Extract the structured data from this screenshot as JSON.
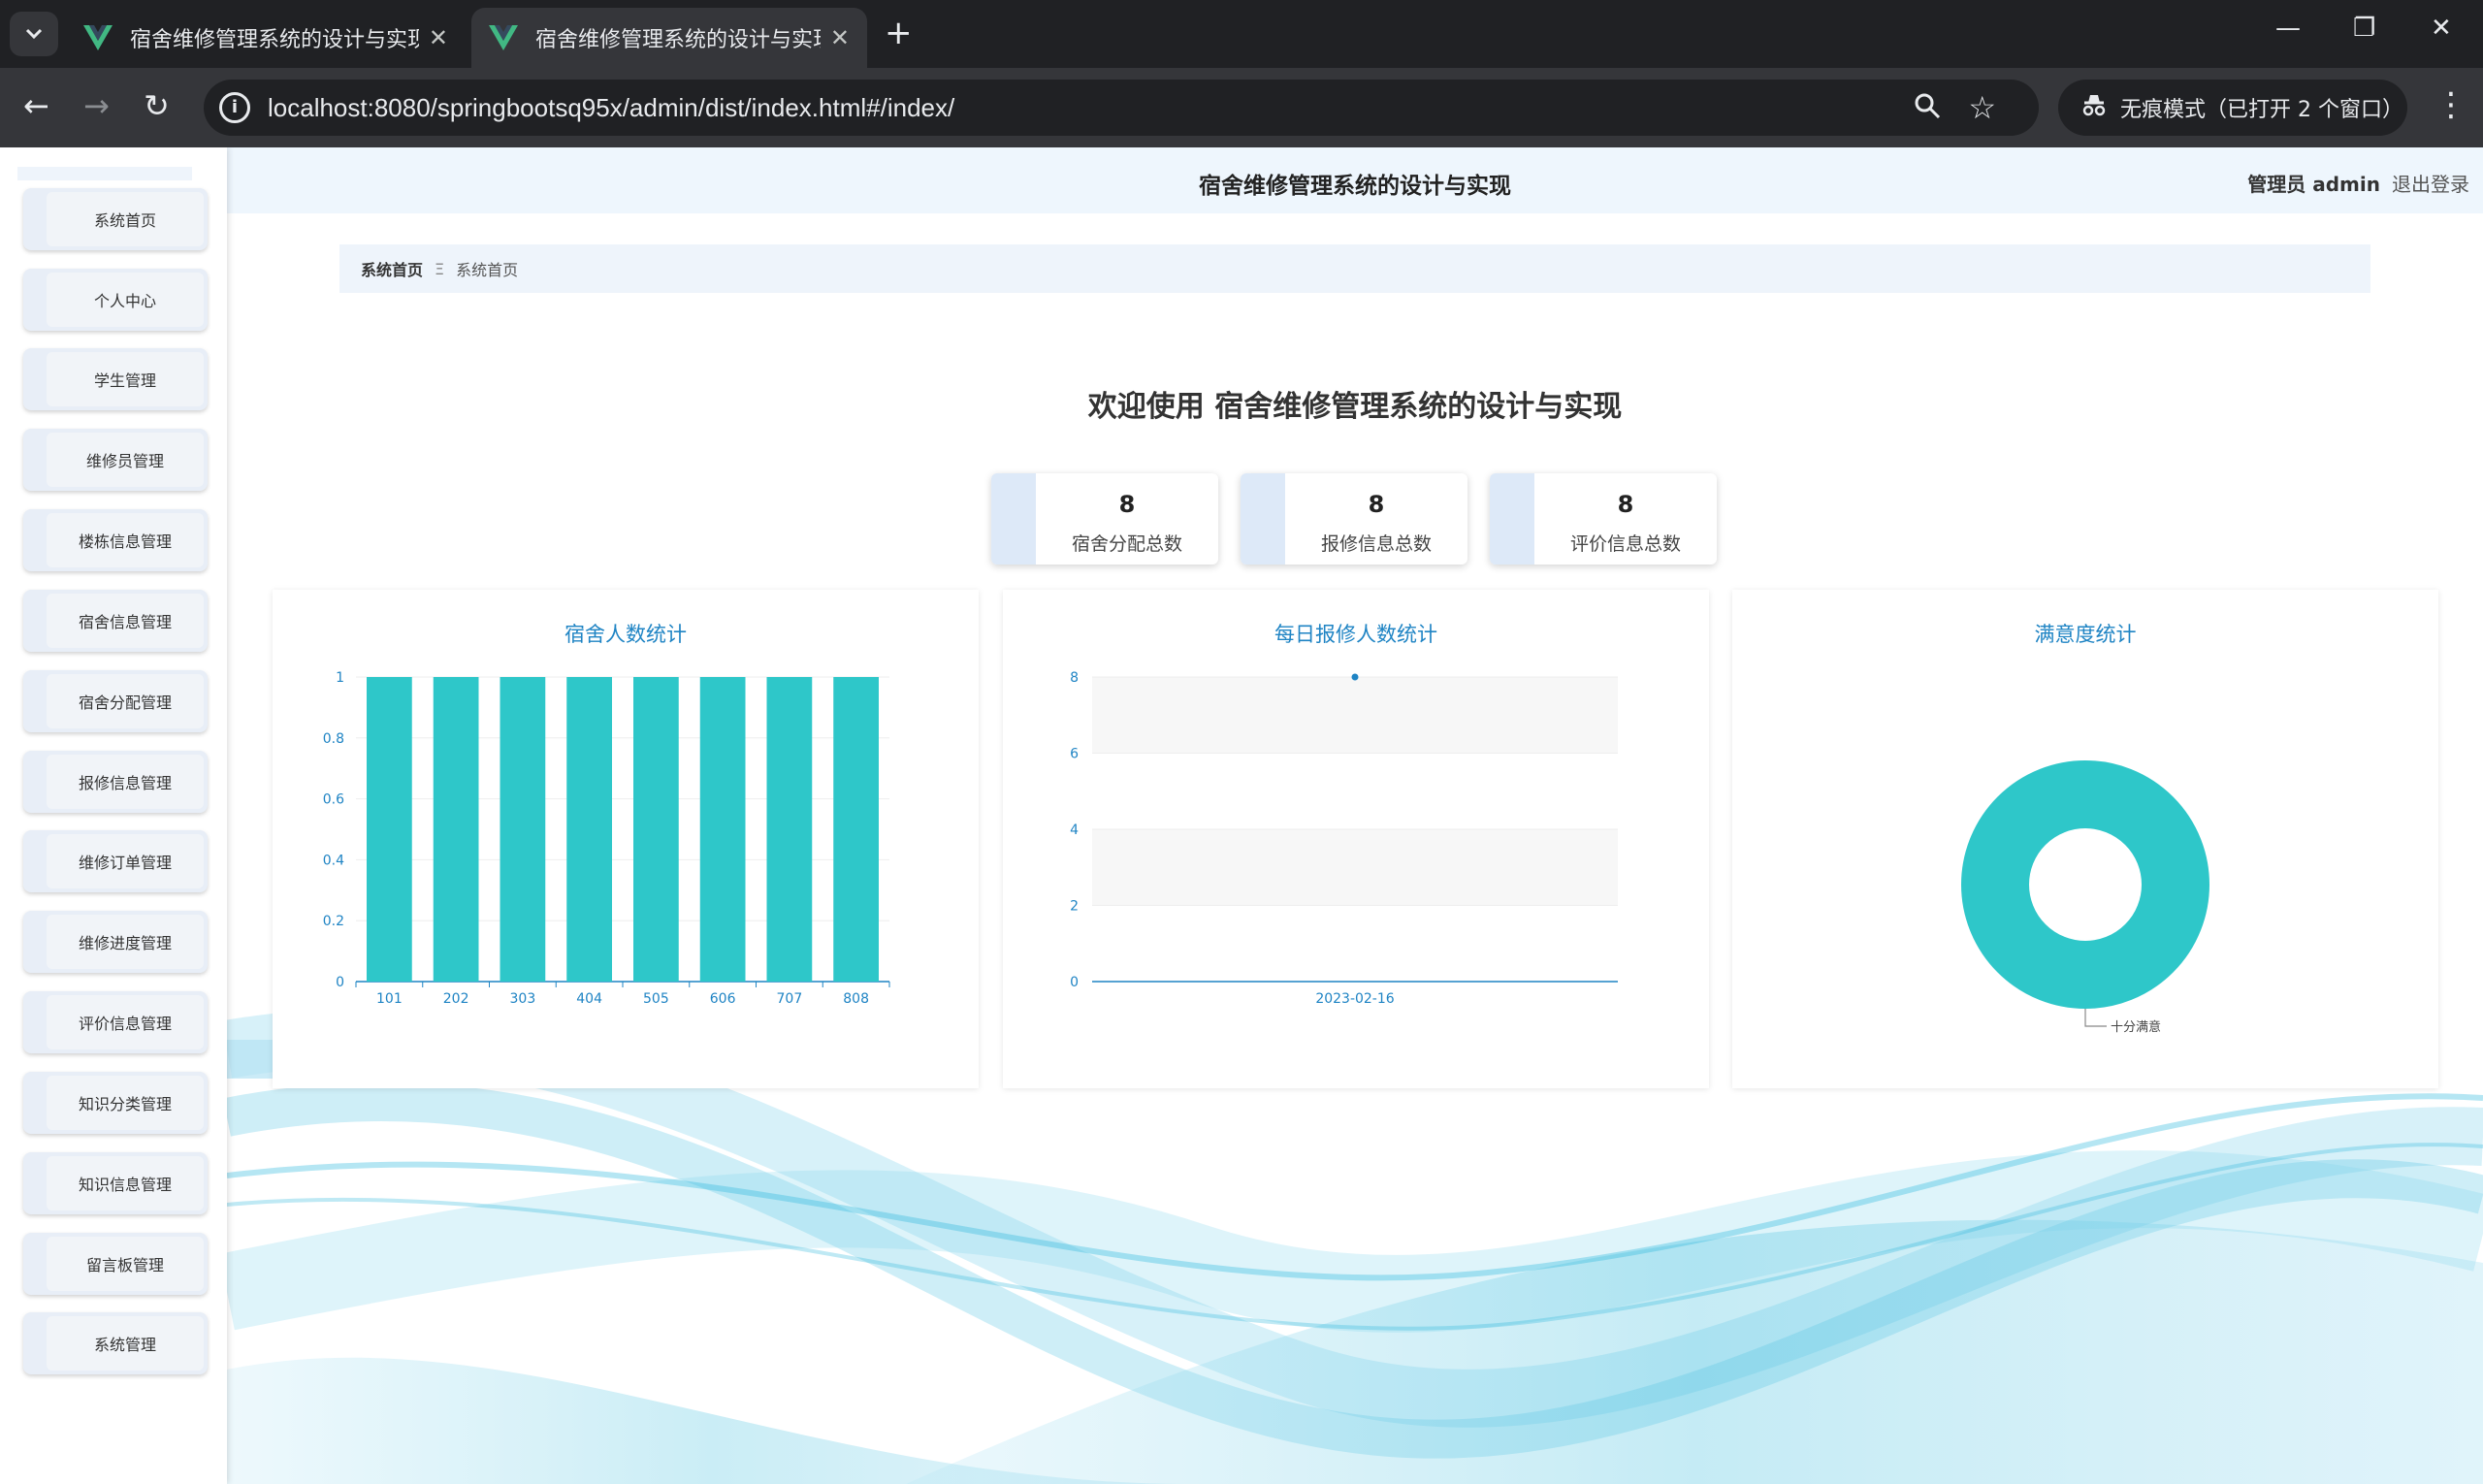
{
  "browser": {
    "tabs": [
      {
        "title": "宿舍维修管理系统的设计与实现",
        "close": "✕"
      },
      {
        "title": "宿舍维修管理系统的设计与实现",
        "close": "✕"
      }
    ],
    "new_tab": "+",
    "url": "localhost:8080/springbootsq95x/admin/dist/index.html#/index/",
    "incognito_label": "无痕模式（已打开 2 个窗口）",
    "win_min": "—",
    "win_restore": "❐",
    "win_close": "✕",
    "icons": [
      "tab-search-icon",
      "vue-logo-icon",
      "back-icon",
      "forward-icon",
      "reload-icon",
      "site-info-icon",
      "zoom-icon",
      "star-icon",
      "incognito-icon",
      "menu-kebab-icon"
    ]
  },
  "sidebar": {
    "items": [
      {
        "label": "系统首页"
      },
      {
        "label": "个人中心"
      },
      {
        "label": "学生管理"
      },
      {
        "label": "维修员管理"
      },
      {
        "label": "楼栋信息管理"
      },
      {
        "label": "宿舍信息管理"
      },
      {
        "label": "宿舍分配管理"
      },
      {
        "label": "报修信息管理"
      },
      {
        "label": "维修订单管理"
      },
      {
        "label": "维修进度管理"
      },
      {
        "label": "评价信息管理"
      },
      {
        "label": "知识分类管理"
      },
      {
        "label": "知识信息管理"
      },
      {
        "label": "留言板管理"
      },
      {
        "label": "系统管理"
      }
    ]
  },
  "header": {
    "title": "宿舍维修管理系统的设计与实现",
    "user": "管理员 admin",
    "logout": "退出登录"
  },
  "breadcrumb": {
    "first": "系统首页",
    "separator": "Ξ",
    "current": "系统首页"
  },
  "welcome": "欢迎使用 宿舍维修管理系统的设计与实现",
  "stats": [
    {
      "value": "8",
      "label": "宿舍分配总数"
    },
    {
      "value": "8",
      "label": "报修信息总数"
    },
    {
      "value": "8",
      "label": "评价信息总数"
    }
  ],
  "colors": {
    "bar": "#2ec7c9",
    "axis": "#1f84c4",
    "pie": "#2ec7c9",
    "wave": "#4fc3e0"
  },
  "chart_data": [
    {
      "type": "bar",
      "title": "宿舍人数统计",
      "categories": [
        "101",
        "202",
        "303",
        "404",
        "505",
        "606",
        "707",
        "808"
      ],
      "values": [
        1,
        1,
        1,
        1,
        1,
        1,
        1,
        1
      ],
      "yticks": [
        "0",
        "0.2",
        "0.4",
        "0.6",
        "0.8",
        "1"
      ],
      "ylim": [
        0,
        1
      ],
      "grid": true
    },
    {
      "type": "line",
      "title": "每日报修人数统计",
      "x": [
        "2023-02-16"
      ],
      "values": [
        8
      ],
      "yticks": [
        "0",
        "2",
        "4",
        "6",
        "8"
      ],
      "ylim": [
        0,
        8
      ],
      "grid": true
    },
    {
      "type": "pie",
      "title": "满意度统计",
      "labels": [
        "十分满意"
      ],
      "values": [
        1
      ]
    }
  ]
}
